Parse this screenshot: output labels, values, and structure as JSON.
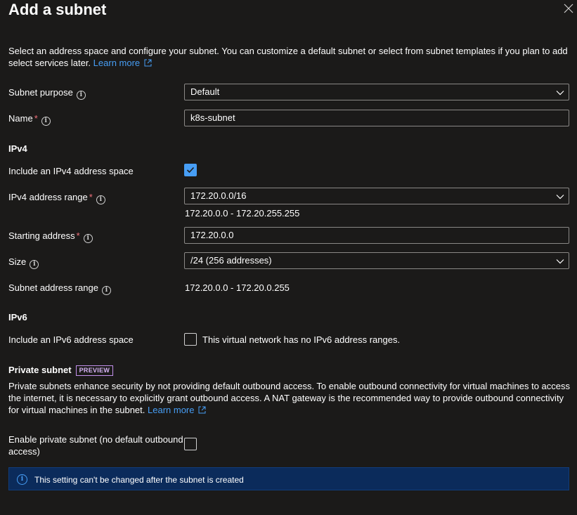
{
  "panel": {
    "title": "Add a subnet",
    "description": "Select an address space and configure your subnet. You can customize a default subnet or select from subnet templates if you plan to add select services later.",
    "learn_more": "Learn more"
  },
  "form": {
    "subnet_purpose": {
      "label": "Subnet purpose",
      "value": "Default"
    },
    "name": {
      "label": "Name",
      "required": "*",
      "value": "k8s-subnet"
    },
    "ipv4": {
      "section": "IPv4",
      "include_label": "Include an IPv4 address space",
      "include_checked": true,
      "range_label": "IPv4 address range",
      "range_required": "*",
      "range_value": "172.20.0.0/16",
      "range_hint": "172.20.0.0 - 172.20.255.255",
      "start_label": "Starting address",
      "start_required": "*",
      "start_value": "172.20.0.0",
      "size_label": "Size",
      "size_value": "/24 (256 addresses)",
      "subnet_range_label": "Subnet address range",
      "subnet_range_value": "172.20.0.0 - 172.20.0.255"
    },
    "ipv6": {
      "section": "IPv6",
      "include_label": "Include an IPv6 address space",
      "include_checked": false,
      "note": "This virtual network has no IPv6 address ranges."
    },
    "private": {
      "section": "Private subnet",
      "badge": "PREVIEW",
      "description": "Private subnets enhance security by not providing default outbound access. To enable outbound connectivity for virtual machines to access the internet, it is necessary to explicitly grant outbound access. A NAT gateway is the recommended way to provide outbound connectivity for virtual machines in the subnet.",
      "learn_more": "Learn more",
      "enable_label_line1": "Enable private subnet (no default outbound",
      "enable_label_line2": "access)",
      "enable_checked": false
    },
    "banner": "This setting can't be changed after the subnet is created"
  },
  "icons": {
    "close": "close-icon",
    "info": "info-icon",
    "chevron": "chevron-down-icon",
    "external": "external-link-icon",
    "check": "checkmark-icon"
  },
  "colors": {
    "background": "#1b1a19",
    "accent": "#479ef5",
    "required": "#f1707b",
    "badge": "#c390ec",
    "banner": "#0b2b5b"
  }
}
